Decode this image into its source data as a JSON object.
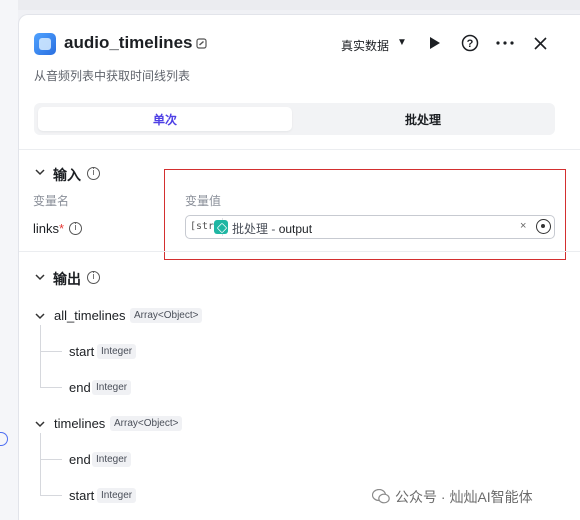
{
  "header": {
    "title": "audio_timelines",
    "subtitle": "从音频列表中获取时间线列表",
    "mode_label": "真实数据",
    "icons": [
      "edit-icon",
      "play-icon",
      "help-icon",
      "more-icon",
      "close-icon"
    ]
  },
  "tabs": [
    {
      "label": "单次",
      "active": true
    },
    {
      "label": "批处理",
      "active": false
    }
  ],
  "input_section": {
    "title": "输入",
    "col_name": "变量名",
    "col_value": "变量值",
    "params": [
      {
        "name": "links",
        "required": "*",
        "type_tag": "[str]",
        "ref_source": "批处理",
        "ref_sep": " - ",
        "ref_output": "output"
      }
    ]
  },
  "output_section": {
    "title": "输出",
    "groups": [
      {
        "name": "all_timelines",
        "type": "Array<Object>",
        "children": [
          {
            "name": "start",
            "type": "Integer"
          },
          {
            "name": "end",
            "type": "Integer"
          }
        ]
      },
      {
        "name": "timelines",
        "type": "Array<Object>",
        "children": [
          {
            "name": "end",
            "type": "Integer"
          },
          {
            "name": "start",
            "type": "Integer"
          }
        ]
      }
    ]
  },
  "watermark": "公众号 · 灿灿AI智能体",
  "colors": {
    "accent": "#4e40e5",
    "highlight_border": "#d32f2f",
    "ref_icon": "#1fb6a3"
  }
}
